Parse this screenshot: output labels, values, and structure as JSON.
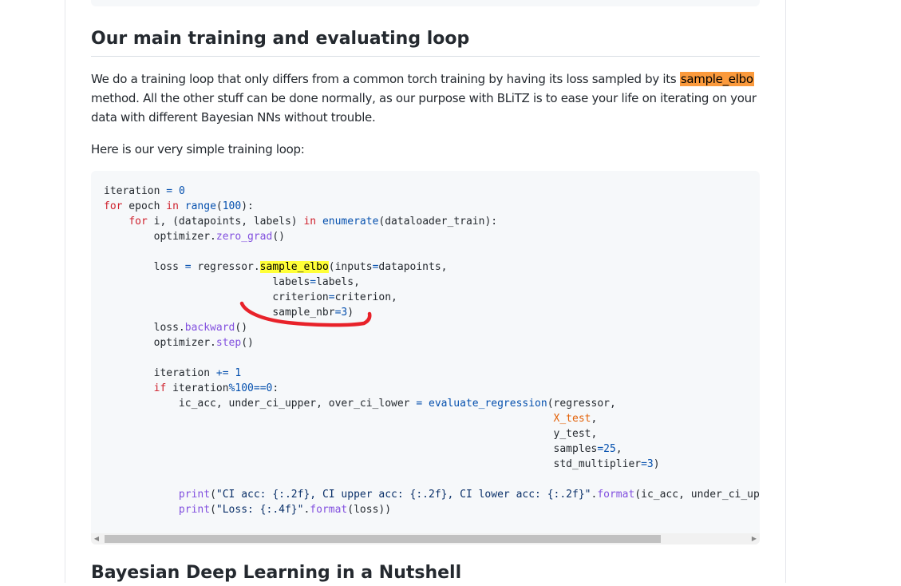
{
  "section": {
    "heading": "Our main training and evaluating loop",
    "para1_before": "We do a training loop that only differs from a common torch training by having its loss sampled by its ",
    "para1_highlight": "sample_elbo",
    "para1_after": " method. All the other stuff can be done normally, as our purpose with BLiTZ is to ease your life on iterating on your data with different Bayesian NNs without trouble.",
    "para2": "Here is our very simple training loop:"
  },
  "code_lines": [
    "iteration = 0",
    "for epoch in range(100):",
    "    for i, (datapoints, labels) in enumerate(dataloader_train):",
    "        optimizer.zero_grad()",
    "",
    "        loss = regressor.sample_elbo(inputs=datapoints,",
    "                           labels=labels,",
    "                           criterion=criterion,",
    "                           sample_nbr=3)",
    "        loss.backward()",
    "        optimizer.step()",
    "",
    "        iteration += 1",
    "        if iteration%100==0:",
    "            ic_acc, under_ci_upper, over_ci_lower = evaluate_regression(regressor,",
    "                                                                        X_test,",
    "                                                                        y_test,",
    "                                                                        samples=25,",
    "                                                                        std_multiplier=3)",
    "",
    "            print(\"CI acc: {:.2f}, CI upper acc: {:.2f}, CI lower acc: {:.2f}\".format(ic_acc, under_ci_upper,",
    "            print(\"Loss: {:.4f}\".format(loss))"
  ],
  "next_section": {
    "heading": "Bayesian Deep Learning in a Nutshell"
  },
  "colors": {
    "highlight_orange": "#fb9a3c",
    "highlight_yellow": "#ffff38",
    "annotation_red": "#e8222a"
  },
  "icons": {
    "scroll_left": "left-arrow-icon",
    "scroll_right": "right-arrow-icon"
  },
  "scroll": {
    "thumb_fraction": 0.83,
    "position_fraction": 0.0
  }
}
